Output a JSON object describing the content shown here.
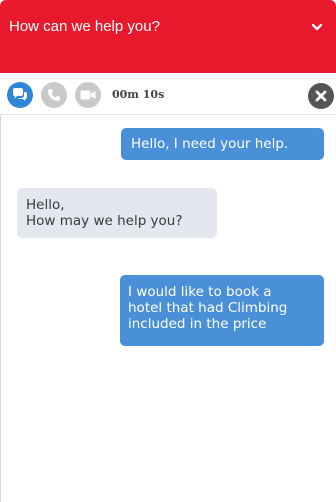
{
  "colors": {
    "header_bg": "#e8192c",
    "user_bubble": "#4a90d9",
    "agent_bubble": "#e4e8ee",
    "active_icon_bg": "#2f86d6",
    "inactive_icon_bg": "#c9c9c9",
    "close_bg": "#555555"
  },
  "header": {
    "title": "How can we help you?",
    "toggle_icon": "chevron-down-icon"
  },
  "toolbar": {
    "chat_icon": "chat-bubbles-icon",
    "call_icon": "phone-icon",
    "video_icon": "video-camera-icon",
    "timer": "00m 10s",
    "close_icon": "close-icon"
  },
  "messages": [
    {
      "sender": "user",
      "text": "Hello, I need your help."
    },
    {
      "sender": "agent",
      "text": "Hello,\nHow may we help you?"
    },
    {
      "sender": "user",
      "text": "I would like to book a\nhotel that had Climbing\nincluded in the price"
    }
  ]
}
